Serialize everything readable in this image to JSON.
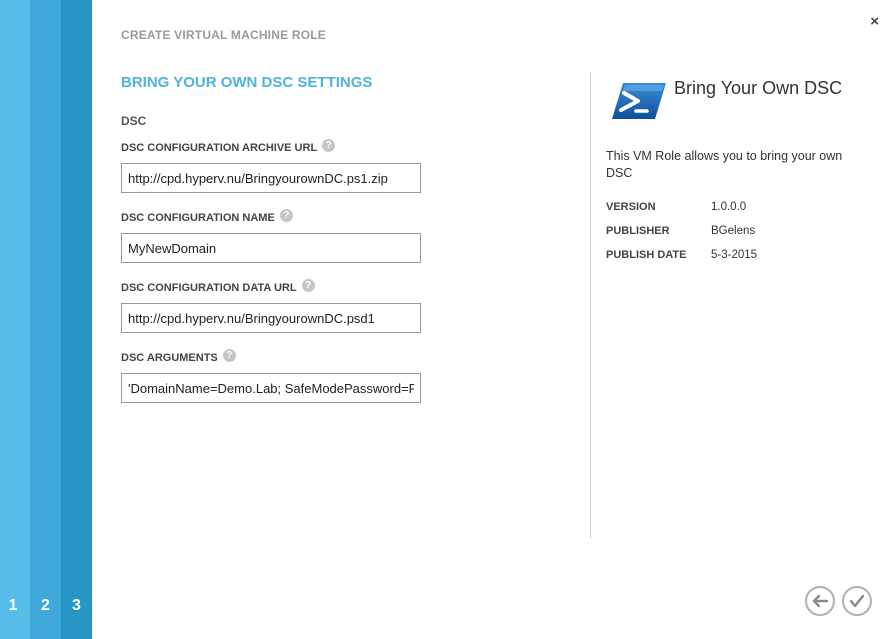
{
  "steps": [
    "1",
    "2",
    "3"
  ],
  "dialog": {
    "title": "CREATE VIRTUAL MACHINE ROLE",
    "close_label": "×"
  },
  "form": {
    "section_title": "BRING YOUR OWN DSC SETTINGS",
    "group_label": "DSC",
    "help_glyph": "?",
    "fields": [
      {
        "label": "DSC CONFIGURATION ARCHIVE URL",
        "value": "http://cpd.hyperv.nu/BringyourownDC.ps1.zip"
      },
      {
        "label": "DSC CONFIGURATION NAME",
        "value": "MyNewDomain"
      },
      {
        "label": "DSC CONFIGURATION DATA URL",
        "value": "http://cpd.hyperv.nu/BringyourownDC.psd1"
      },
      {
        "label": "DSC ARGUMENTS",
        "value": "'DomainName=Demo.Lab; SafeModePassword=Pa"
      }
    ]
  },
  "role": {
    "icon": "powershell-icon",
    "name": "Bring Your Own DSC",
    "description": "This VM Role allows you to bring your own DSC",
    "meta": [
      {
        "key": "VERSION",
        "value": "1.0.0.0"
      },
      {
        "key": "PUBLISHER",
        "value": "BGelens"
      },
      {
        "key": "PUBLISH DATE",
        "value": "5-3-2015"
      }
    ]
  },
  "nav": {
    "back_icon": "arrow-left-icon",
    "finish_icon": "checkmark-icon"
  },
  "colors": {
    "step1": "#56bde9",
    "step2": "#3ea9d9",
    "step3": "#2896c4",
    "accent": "#4fb3db"
  }
}
